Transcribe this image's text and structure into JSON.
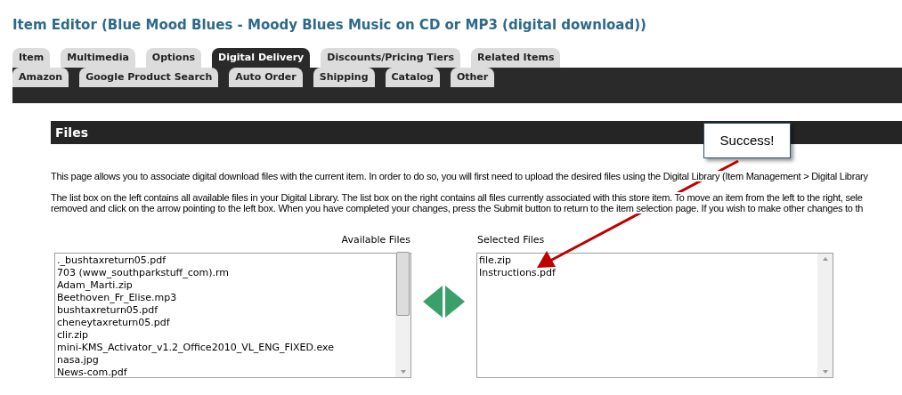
{
  "title": "Item Editor (Blue Mood Blues - Moody Blues Music on CD or MP3 (digital download))",
  "tab_rows": [
    [
      {
        "label": "Item",
        "selected": false
      },
      {
        "label": "Multimedia",
        "selected": false
      },
      {
        "label": "Options",
        "selected": false
      },
      {
        "label": "Digital Delivery",
        "selected": true
      },
      {
        "label": "Discounts/Pricing Tiers",
        "selected": false
      },
      {
        "label": "Related Items",
        "selected": false
      }
    ],
    [
      {
        "label": "Amazon",
        "selected": false
      },
      {
        "label": "Google Product Search",
        "selected": false
      },
      {
        "label": "Auto Order",
        "selected": false
      },
      {
        "label": "Shipping",
        "selected": false
      },
      {
        "label": "Catalog",
        "selected": false
      },
      {
        "label": "Other",
        "selected": false
      }
    ]
  ],
  "section": {
    "title": "Files"
  },
  "paragraphs": [
    [
      "This page allows you to associate digital download files with the current item. In order to do so, you will first need to upload the desired files using the Digital Library (Item Management > Digital Library"
    ],
    [
      "The list box on the left contains all available files in your Digital Library. The list box on the right contains all files currently associated with this store item. To move an item from the left to the right, sele",
      "removed and click on the arrow pointing to the left box. When you have completed your changes, press the Submit button to return to the item selection page. If you wish to make other changes to th"
    ]
  ],
  "available_files": {
    "label": "Available Files",
    "items": [
      "._bushtaxreturn05.pdf",
      "703 (www_southparkstuff_com).rm",
      "Adam_Marti.zip",
      "Beethoven_Fr_Elise.mp3",
      "bushtaxreturn05.pdf",
      "cheneytaxreturn05.pdf",
      "clir.zip",
      "mini-KMS_Activator_v1.2_Office2010_VL_ENG_FIXED.exe",
      "nasa.jpg",
      "News-com.pdf"
    ]
  },
  "selected_files": {
    "label": "Selected Files",
    "items": [
      "file.zip",
      "Instructions.pdf"
    ]
  },
  "callout": {
    "text": "Success!"
  }
}
